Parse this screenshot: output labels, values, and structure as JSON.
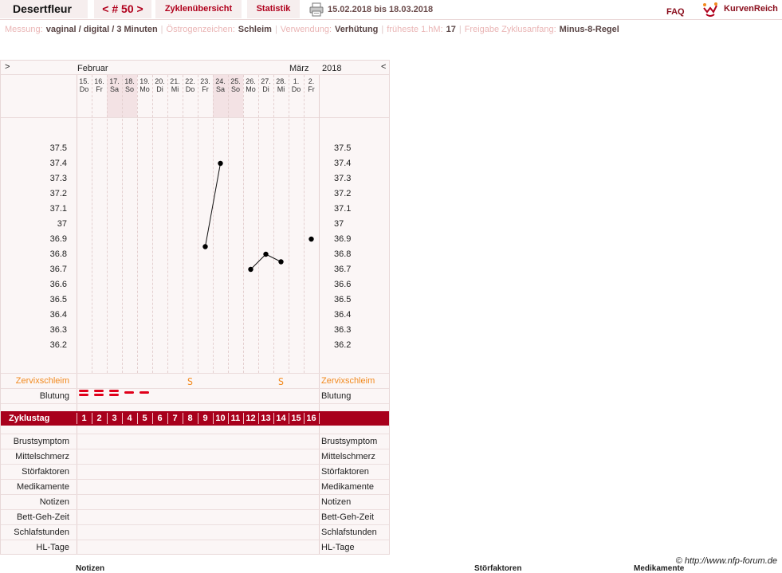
{
  "app": {
    "title": "Desertfleur",
    "cycle_label": "< # 50 >",
    "nav_overview": "Zyklenübersicht",
    "nav_stats": "Statistik",
    "date_range": "15.02.2018 bis 18.03.2018",
    "faq": "FAQ",
    "logo_text": "KurvenReich"
  },
  "info": {
    "measurement_label": "Messung:",
    "measurement_value": "vaginal / digital / 3 Minuten",
    "estrogen_label": "Östrogenzeichen:",
    "estrogen_value": "Schleim",
    "usage_label": "Verwendung:",
    "usage_value": "Verhütung",
    "earliest_label": "früheste 1.hM:",
    "earliest_value": "17",
    "release_label": "Freigabe Zyklusanfang:",
    "release_value": "Minus-8-Regel"
  },
  "chart_header": {
    "prev": ">",
    "next": "<",
    "month_1": "Februar",
    "month_2": "März",
    "year": "2018"
  },
  "days": [
    {
      "date": "15.",
      "wd": "Do",
      "weekend": false
    },
    {
      "date": "16.",
      "wd": "Fr",
      "weekend": false
    },
    {
      "date": "17.",
      "wd": "Sa",
      "weekend": true
    },
    {
      "date": "18.",
      "wd": "So",
      "weekend": true
    },
    {
      "date": "19.",
      "wd": "Mo",
      "weekend": false
    },
    {
      "date": "20.",
      "wd": "Di",
      "weekend": false
    },
    {
      "date": "21.",
      "wd": "Mi",
      "weekend": false
    },
    {
      "date": "22.",
      "wd": "Do",
      "weekend": false
    },
    {
      "date": "23.",
      "wd": "Fr",
      "weekend": false
    },
    {
      "date": "24.",
      "wd": "Sa",
      "weekend": true
    },
    {
      "date": "25.",
      "wd": "So",
      "weekend": true
    },
    {
      "date": "26.",
      "wd": "Mo",
      "weekend": false
    },
    {
      "date": "27.",
      "wd": "Di",
      "weekend": false
    },
    {
      "date": "28.",
      "wd": "Mi",
      "weekend": false
    },
    {
      "date": "1.",
      "wd": "Do",
      "weekend": false
    },
    {
      "date": "2.",
      "wd": "Fr",
      "weekend": false
    }
  ],
  "temp_ticks": [
    "37.5",
    "37.4",
    "37.3",
    "37.2",
    "37.1",
    "37",
    "36.9",
    "36.8",
    "36.7",
    "36.6",
    "36.5",
    "36.4",
    "36.3",
    "36.2"
  ],
  "chart_data": {
    "type": "line",
    "x": [
      9,
      10,
      12,
      13,
      14,
      16
    ],
    "y": [
      36.85,
      37.4,
      36.7,
      36.8,
      36.75,
      36.9
    ],
    "segments": [
      [
        9,
        10
      ],
      [
        12,
        14
      ]
    ],
    "ylim": [
      36.2,
      37.5
    ],
    "xlim": [
      1,
      16
    ]
  },
  "rows": {
    "zervix": "Zervixschleim",
    "blutung": "Blutung",
    "zyklustag": "Zyklustag",
    "brust": "Brustsymptom",
    "mittel": "Mittelschmerz",
    "stoer": "Störfaktoren",
    "medi": "Medikamente",
    "notizen": "Notizen",
    "bett": "Bett-Geh-Zeit",
    "schlaf": "Schlafstunden",
    "hl": "HL-Tage"
  },
  "mucus": [
    {
      "day": 8,
      "symbol": "S"
    },
    {
      "day": 14,
      "symbol": "S"
    }
  ],
  "bleeding": [
    {
      "day": 1,
      "level": 3
    },
    {
      "day": 2,
      "level": 3
    },
    {
      "day": 3,
      "level": 3
    },
    {
      "day": 4,
      "level": 1
    },
    {
      "day": 5,
      "level": 1
    }
  ],
  "cycle_days": [
    "1",
    "2",
    "3",
    "4",
    "5",
    "6",
    "7",
    "8",
    "9",
    "10",
    "11",
    "12",
    "13",
    "14",
    "15",
    "16"
  ],
  "footer": {
    "credit": "© http://www.nfp-forum.de",
    "col_notizen": "Notizen",
    "col_stoer": "Störfaktoren",
    "col_medi": "Medikamente"
  },
  "colors": {
    "accent": "#b0001c",
    "zyklus_bar": "#a8001c",
    "mucus": "#f28a1f",
    "bleeding": "#e0001a"
  }
}
